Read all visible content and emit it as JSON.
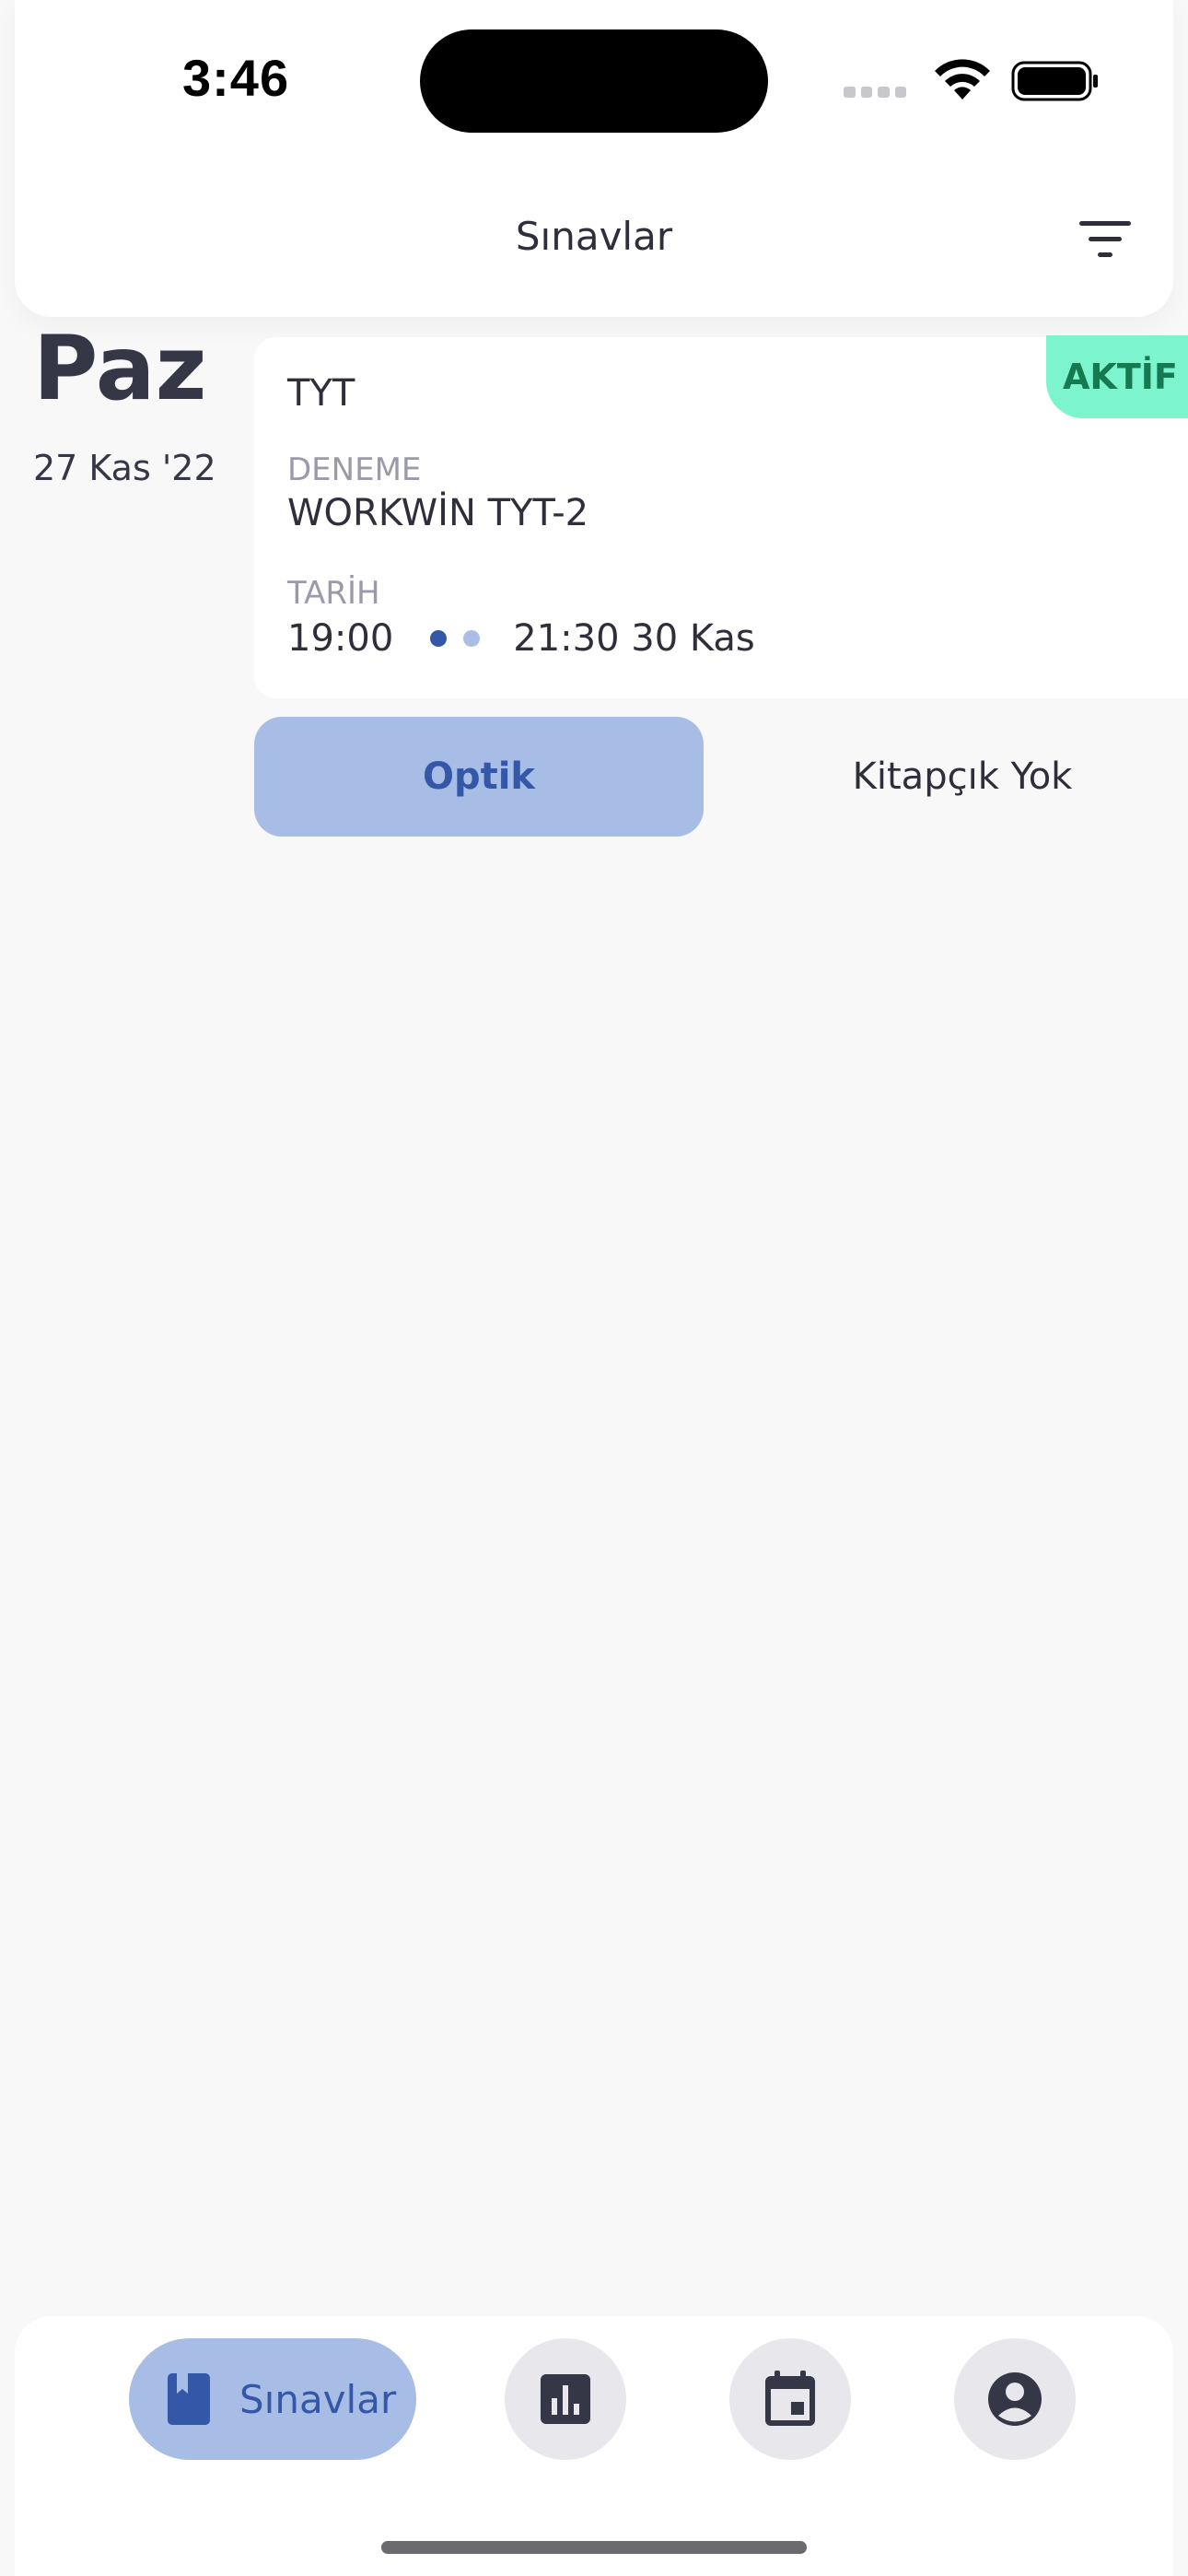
{
  "status_bar": {
    "time": "3:46"
  },
  "header": {
    "title": "Sınavlar"
  },
  "exam": {
    "day_name": "Paz",
    "date": "27 Kas '22",
    "status": "AKTİF",
    "type": "TYT",
    "deneme_label": "DENEME",
    "deneme_value": "WORKWİN TYT-2",
    "tarih_label": "TARİH",
    "start_time": "19:00",
    "end_time": "21:30 30 Kas",
    "optik_label": "Optik",
    "booklet_status": "Kitapçık Yok"
  },
  "bottom_nav": {
    "active_label": "Sınavlar",
    "items": [
      "book-icon",
      "bar-chart-icon",
      "calendar-icon",
      "account-circle-icon"
    ]
  },
  "colors": {
    "accent": "#3457a8",
    "accent_light": "#a8bde6",
    "active_badge_bg": "#7cf5cf",
    "active_badge_text": "#157a52",
    "background": "#f8f8f9"
  }
}
